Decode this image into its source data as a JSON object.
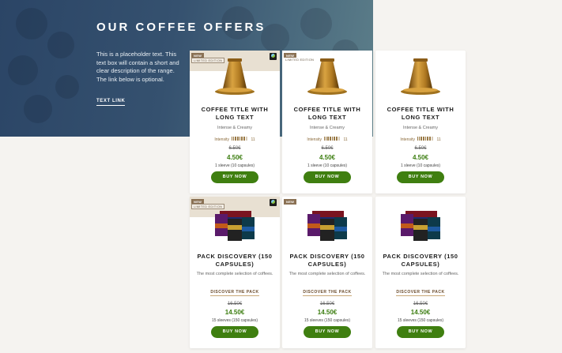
{
  "hero": {
    "title": "OUR COFFEE OFFERS",
    "description": "This is a placeholder text. This text box will contain a short and clear description of the range. The link below is optional.",
    "link_label": "TEXT LINK"
  },
  "coffee_cards": [
    {
      "badge_new": "NEW",
      "badge_limited": "LIMITED EDITION",
      "fairtrade": true,
      "title": "COFFEE TITLE WITH LONG TEXT",
      "subtitle": "Intense & Creamy",
      "intensity_label": "Intensity",
      "intensity_value": "11",
      "intensity_level": 11,
      "intensity_max": 13,
      "old_price": "6.50€",
      "price": "4.50€",
      "quantity": "1 sleeve (10 capsules)",
      "button_label": "BUY NOW"
    },
    {
      "badge_new": "NEW",
      "badge_limited": "LIMITED EDITION",
      "fairtrade": false,
      "title": "COFFEE TITLE WITH LONG TEXT",
      "subtitle": "Intense & Creamy",
      "intensity_label": "Intensity",
      "intensity_value": "11",
      "intensity_level": 11,
      "intensity_max": 13,
      "old_price": "6.50€",
      "price": "4.50€",
      "quantity": "1 sleeve (10 capsules)",
      "button_label": "BUY NOW"
    },
    {
      "badge_new": "",
      "badge_limited": "",
      "fairtrade": false,
      "title": "COFFEE TITLE WITH LONG TEXT",
      "subtitle": "Intense & Creamy",
      "intensity_label": "Intensity",
      "intensity_value": "11",
      "intensity_level": 11,
      "intensity_max": 13,
      "old_price": "6.50€",
      "price": "4.50€",
      "quantity": "1 sleeve (10 capsules)",
      "button_label": "BUY NOW"
    }
  ],
  "pack_cards": [
    {
      "badge_new": "NEW",
      "badge_limited": "LIMITED EDITION",
      "fairtrade": true,
      "title": "PACK DISCOVERY (150 CAPSULES)",
      "description": "The most complete selection of coffees.",
      "discover_label": "DISCOVER THE PACK",
      "old_price": "16.50€",
      "price": "14.50€",
      "quantity": "15 sleeves (150 capsules)",
      "button_label": "BUY NOW"
    },
    {
      "badge_new": "NEW",
      "badge_limited": "",
      "fairtrade": false,
      "title": "PACK DISCOVERY (150 CAPSULES)",
      "description": "The most complete selection of coffees.",
      "discover_label": "DISCOVER THE PACK",
      "old_price": "16.50€",
      "price": "14.50€",
      "quantity": "15 sleeves (150 capsules)",
      "button_label": "BUY NOW"
    },
    {
      "badge_new": "",
      "badge_limited": "",
      "fairtrade": false,
      "title": "PACK DISCOVERY (150 CAPSULES)",
      "description": "The most complete selection of coffees.",
      "discover_label": "DISCOVER THE PACK",
      "old_price": "16.50€",
      "price": "14.50€",
      "quantity": "15 sleeves (150 capsules)",
      "button_label": "BUY NOW"
    }
  ],
  "colors": {
    "price_green": "#3b7d0f",
    "button_green": "#3f7f10",
    "hero_blue": "#2b4566",
    "capsule_gold": "#b9832a"
  }
}
